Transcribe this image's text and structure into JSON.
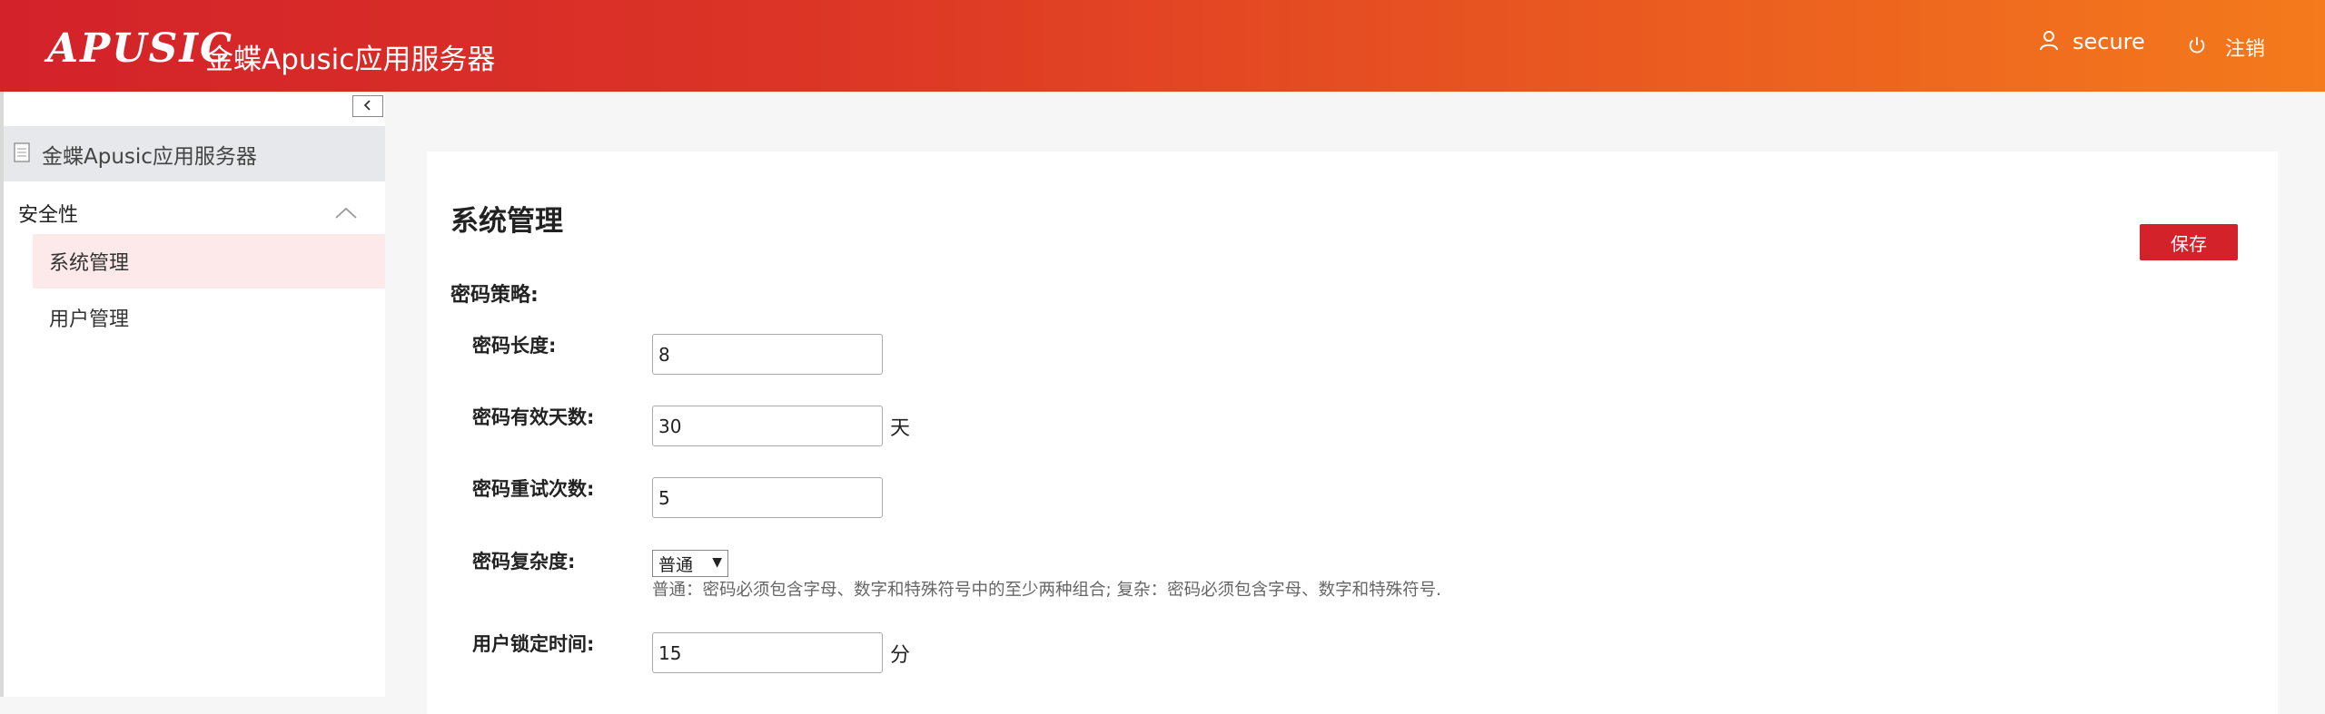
{
  "header": {
    "logo_text": "APUSIC",
    "app_title": "金蝶Apusic应用服务器",
    "username": "secure",
    "logout_label": "注销"
  },
  "sidebar": {
    "root_label": "金蝶Apusic应用服务器",
    "group_label": "安全性",
    "items": [
      {
        "label": "系统管理",
        "active": true
      },
      {
        "label": "用户管理",
        "active": false
      }
    ]
  },
  "main": {
    "title": "系统管理",
    "save_label": "保存",
    "section_label": "密码策略:",
    "fields": {
      "password_length": {
        "label": "密码长度:",
        "value": "8"
      },
      "password_valid_days": {
        "label": "密码有效天数:",
        "value": "30",
        "unit": "天"
      },
      "password_retry": {
        "label": "密码重试次数:",
        "value": "5"
      },
      "password_complexity": {
        "label": "密码复杂度:",
        "selected": "普通",
        "hint": "普通：密码必须包含字母、数字和特殊符号中的至少两种组合; 复杂：密码必须包含字母、数字和特殊符号."
      },
      "user_lock_time": {
        "label": "用户锁定时间:",
        "value": "15",
        "unit": "分"
      }
    }
  },
  "colors": {
    "header_start": "#d3222a",
    "header_end": "#f47a1c",
    "accent": "#d3222a",
    "active_item_bg": "#fde9e9"
  },
  "icons": [
    "user-icon",
    "power-icon",
    "collapse-icon",
    "document-icon",
    "chevron-up-icon"
  ]
}
